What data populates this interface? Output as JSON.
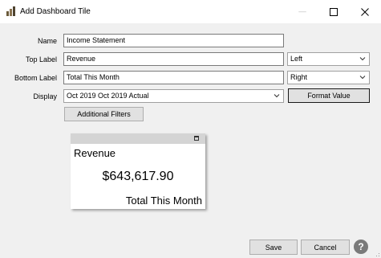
{
  "window": {
    "title": "Add Dashboard Tile",
    "minimize_glyph": "—",
    "maximize_glyph": "☐",
    "close_glyph": "✕"
  },
  "form": {
    "name": {
      "label": "Name",
      "value": "Income Statement"
    },
    "top_label": {
      "label": "Top Label",
      "value": "Revenue",
      "align": "Left"
    },
    "bottom_label": {
      "label": "Bottom Label",
      "value": "Total This Month",
      "align": "Right"
    },
    "display": {
      "label": "Display",
      "value": "Oct 2019 Oct 2019 Actual"
    },
    "format_value_button": "Format Value",
    "additional_filters_button": "Additional Filters"
  },
  "tile": {
    "top_text": "Revenue",
    "value": "$643,617.90",
    "bottom_text": "Total This Month"
  },
  "footer": {
    "save_button": "Save",
    "cancel_button": "Cancel",
    "help_glyph": "?"
  },
  "icons": {
    "app": "dashboard-app-icon",
    "dropdown": "chevron-down-icon",
    "help": "help-icon"
  }
}
